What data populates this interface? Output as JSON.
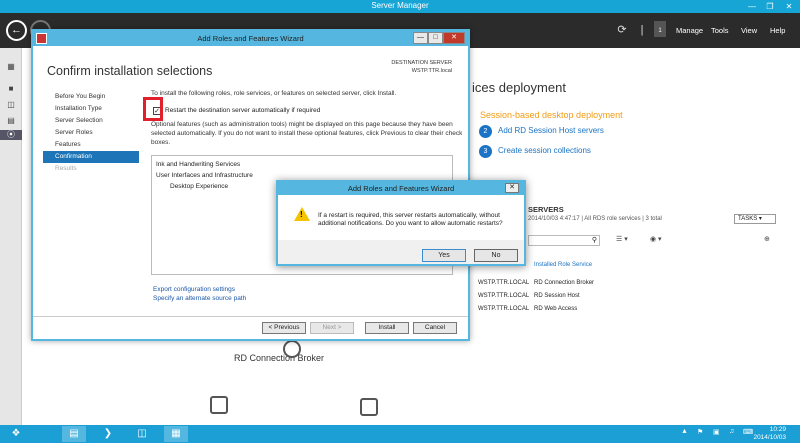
{
  "window": {
    "title": "Server Manager",
    "minimize": "—",
    "restore": "❐",
    "close": "✕"
  },
  "header": {
    "breadcrumb_hidden": "",
    "menus": [
      "Manage",
      "Tools",
      "View",
      "Help"
    ],
    "notification_count": "1"
  },
  "background": {
    "deployment_title": "ices deployment",
    "deployment_subtitle": "Session-based desktop deployment",
    "steps": [
      {
        "num": "2",
        "label": "Add RD Session Host servers"
      },
      {
        "num": "3",
        "label": "Create session collections"
      }
    ],
    "servers_title": "SERVERS",
    "servers_subtitle": "2014/10/03 4:47:17 | All RDS role services | 3 total",
    "tasks_label": "TASKS",
    "column_header": "Installed Role Service",
    "rows": [
      {
        "server": "WSTP.TTR.LOCAL",
        "role": "RD Connection Broker"
      },
      {
        "server": "WSTP.TTR.LOCAL",
        "role": "RD Session Host"
      },
      {
        "server": "WSTP.TTR.LOCAL",
        "role": "RD Web Access"
      }
    ],
    "diagram_label": "RD Connection Broker"
  },
  "wizard": {
    "title": "Add Roles and Features Wizard",
    "heading": "Confirm installation selections",
    "destination_label": "DESTINATION SERVER",
    "destination_value": "WSTP.TTR.local",
    "nav": [
      {
        "label": "Before You Begin",
        "state": "normal"
      },
      {
        "label": "Installation Type",
        "state": "normal"
      },
      {
        "label": "Server Selection",
        "state": "normal"
      },
      {
        "label": "Server Roles",
        "state": "normal"
      },
      {
        "label": "Features",
        "state": "normal"
      },
      {
        "label": "Confirmation",
        "state": "selected"
      },
      {
        "label": "Results",
        "state": "disabled"
      }
    ],
    "intro": "To install the following roles, role services, or features on selected server, click Install.",
    "restart_label": "Restart the destination server automatically if required",
    "optional_text": "Optional features (such as administration tools) might be displayed on this page because they have been selected automatically. If you do not want to install these optional features, click Previous to clear their check boxes.",
    "features": [
      {
        "label": "Ink and Handwriting Services",
        "indent": 0
      },
      {
        "label": "User Interfaces and Infrastructure",
        "indent": 0
      },
      {
        "label": "Desktop Experience",
        "indent": 1
      }
    ],
    "export_link": "Export configuration settings",
    "alternate_link": "Specify an alternate source path",
    "buttons": {
      "previous": "< Previous",
      "next": "Next >",
      "install": "Install",
      "cancel": "Cancel"
    }
  },
  "dialog": {
    "title": "Add Roles and Features Wizard",
    "message": "If a restart is required, this server restarts automatically, without additional notifications. Do you want to allow automatic restarts?",
    "yes": "Yes",
    "no": "No"
  },
  "taskbar": {
    "time": "10:29",
    "date": "2014/10/03"
  }
}
